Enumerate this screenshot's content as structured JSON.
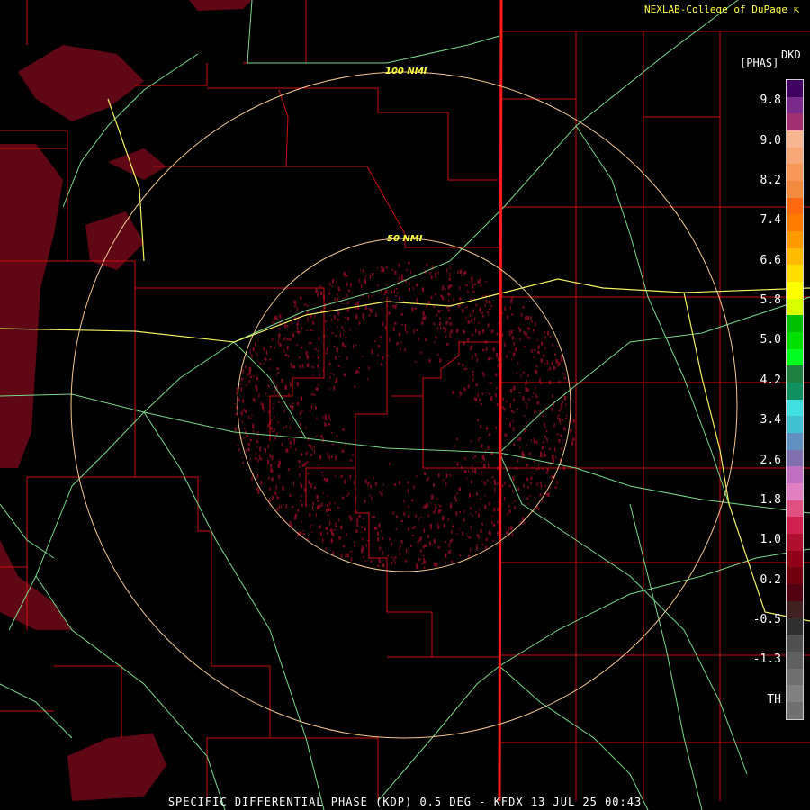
{
  "credit": "NEXLAB-College of DuPage",
  "credit_icon": "external-link-icon",
  "legend": {
    "product": "DKD",
    "units": "[PHAS]",
    "ticks": [
      "9.8",
      "9.0",
      "8.2",
      "7.4",
      "6.6",
      "5.8",
      "5.0",
      "4.2",
      "3.4",
      "2.6",
      "1.8",
      "1.0",
      "0.2",
      "-0.5",
      "-1.3",
      "TH"
    ],
    "colors": [
      "#400060",
      "#7a2a8a",
      "#a03070",
      "#f7b592",
      "#f7a878",
      "#f79858",
      "#f28a40",
      "#ff6a10",
      "#ff7a00",
      "#ff9900",
      "#ffbb00",
      "#ffdd00",
      "#ffff00",
      "#d8ff00",
      "#00c000",
      "#00e000",
      "#00ff20",
      "#208040",
      "#109060",
      "#40e0e0",
      "#40c0d0",
      "#6090c0",
      "#8070b0",
      "#c070c0",
      "#e080c0",
      "#e05080",
      "#d02050",
      "#b01030",
      "#900018",
      "#700010",
      "#500010",
      "#402020",
      "#303030",
      "#505050",
      "#606060",
      "#707070",
      "#808080",
      "#707070"
    ],
    "accent": "#ffff40"
  },
  "range_rings": [
    {
      "label": "100 NMI"
    },
    {
      "label": "50 NMI"
    }
  ],
  "map_colors": {
    "county": "#cc1010",
    "state": "#ff1a1a",
    "highway": "#7ad98a",
    "interstate": "#f0f060",
    "ring": "#f4c890",
    "echo": "#7a0a20"
  },
  "footer": "SPECIFIC DIFFERENTIAL PHASE (KDP) 0.5 DEG - KFDX 13 JUL 25 00:43"
}
